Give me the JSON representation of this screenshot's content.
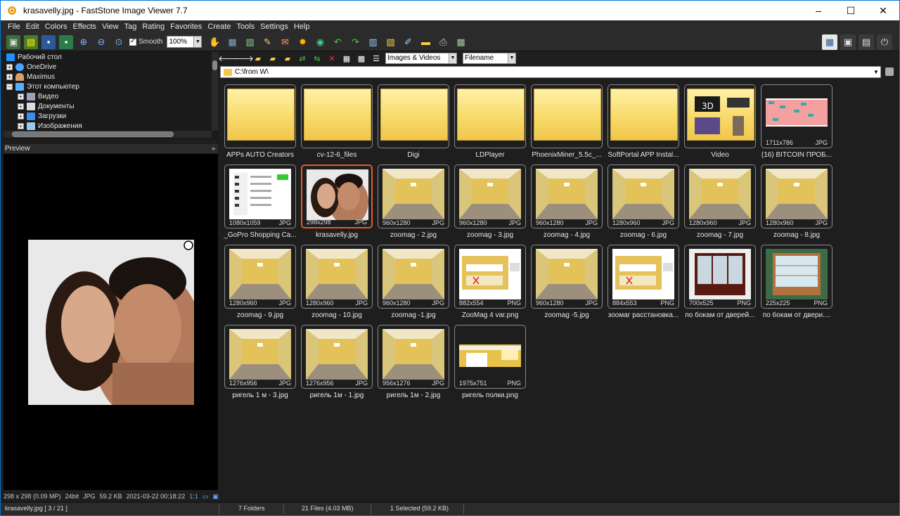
{
  "window": {
    "title": "krasavelly.jpg  -  FastStone Image Viewer 7.7",
    "controls": [
      "–",
      "☐",
      "✕"
    ]
  },
  "menu": [
    "File",
    "Edit",
    "Colors",
    "Effects",
    "View",
    "Tag",
    "Rating",
    "Favorites",
    "Create",
    "Tools",
    "Settings",
    "Help"
  ],
  "toolbar": {
    "smooth_label": "Smooth",
    "zoom_value": "100%"
  },
  "tree": {
    "items": [
      {
        "label": "Рабочий стол",
        "icon": "desktop-icon",
        "color": "#1e90ff"
      },
      {
        "label": "OneDrive",
        "icon": "cloud-icon",
        "color": "#4aa3ff"
      },
      {
        "label": "Maximus",
        "icon": "user-icon",
        "color": "#d9a066"
      },
      {
        "label": "Этот компьютер",
        "icon": "computer-icon",
        "color": "#5ab0ff"
      },
      {
        "label": "Видео",
        "icon": "video-folder-icon",
        "color": "#9aa4b5"
      },
      {
        "label": "Документы",
        "icon": "documents-icon",
        "color": "#dcdcdc"
      },
      {
        "label": "Загрузки",
        "icon": "downloads-icon",
        "color": "#3a8ee6"
      },
      {
        "label": "Изображения",
        "icon": "pictures-icon",
        "color": "#9ec7e8"
      }
    ]
  },
  "preview": {
    "header": "Preview",
    "info": [
      "298 x 298 (0.09 MP)",
      "24bit",
      "JPG",
      "59.2 KB",
      "2021-03-22 00:18:22",
      "1:1"
    ]
  },
  "navbar": {
    "filter_value": "Images & Videos",
    "sort_value": "Filename"
  },
  "path": "C:\\from W\\",
  "thumbnails": [
    {
      "caption": "APPs AUTO Creators",
      "type": "folder"
    },
    {
      "caption": "cv-12-6_files",
      "type": "folder"
    },
    {
      "caption": "Digi",
      "type": "folder"
    },
    {
      "caption": "LDPlayer",
      "type": "folder"
    },
    {
      "caption": "PhoenixMiner_5.5c_...",
      "type": "folder"
    },
    {
      "caption": "SoftPortal APP Instal...",
      "type": "folder"
    },
    {
      "caption": "Video",
      "type": "folder-video"
    },
    {
      "caption": "(16) BITCOIN ПРОБ...",
      "type": "sheet",
      "dims": "1711x786",
      "ext": "JPG"
    },
    {
      "caption": "_GoPro Shopping Ca...",
      "type": "web",
      "dims": "1080x1059",
      "ext": "JPG"
    },
    {
      "caption": "krasavelly.jpg",
      "type": "photo",
      "dims": "298x298",
      "ext": "JPG",
      "selected": true
    },
    {
      "caption": "zoomag - 2.jpg",
      "type": "room",
      "dims": "960x1280",
      "ext": "JPG"
    },
    {
      "caption": "zoomag - 3.jpg",
      "type": "room",
      "dims": "960x1280",
      "ext": "JPG"
    },
    {
      "caption": "zoomag - 4.jpg",
      "type": "room",
      "dims": "960x1280",
      "ext": "JPG"
    },
    {
      "caption": "zoomag - 6.jpg",
      "type": "room",
      "dims": "1280x960",
      "ext": "JPG"
    },
    {
      "caption": "zoomag - 7.jpg",
      "type": "room",
      "dims": "1280x960",
      "ext": "JPG"
    },
    {
      "caption": "zoomag - 8.jpg",
      "type": "room",
      "dims": "1280x960",
      "ext": "JPG"
    },
    {
      "caption": "zoomag - 9.jpg",
      "type": "room",
      "dims": "1280x960",
      "ext": "JPG"
    },
    {
      "caption": "zoomag - 10.jpg",
      "type": "room",
      "dims": "1280x960",
      "ext": "JPG"
    },
    {
      "caption": "zoomag -1.jpg",
      "type": "room",
      "dims": "960x1280",
      "ext": "JPG"
    },
    {
      "caption": "ZooMag 4 var.png",
      "type": "plan",
      "dims": "882x554",
      "ext": "PNG"
    },
    {
      "caption": "zoomag -5.jpg",
      "type": "room",
      "dims": "960x1280",
      "ext": "JPG"
    },
    {
      "caption": "зоомаг расстановка...",
      "type": "plan",
      "dims": "884x553",
      "ext": "PNG"
    },
    {
      "caption": "по бокам от дверей...",
      "type": "cabinet",
      "dims": "700x525",
      "ext": "PNG"
    },
    {
      "caption": "по бокам от двери....",
      "type": "cabinet2",
      "dims": "225x225",
      "ext": "PNG"
    },
    {
      "caption": "ригель 1 м - 3.jpg",
      "type": "room",
      "dims": "1276x956",
      "ext": "JPG"
    },
    {
      "caption": "ригель 1м - 1.jpg",
      "type": "room",
      "dims": "1276x956",
      "ext": "JPG"
    },
    {
      "caption": "ригель 1м - 2.jpg",
      "type": "room",
      "dims": "956x1276",
      "ext": "JPG"
    },
    {
      "caption": "ригель полки.png",
      "type": "shelf",
      "dims": "1975x751",
      "ext": "PNG"
    }
  ],
  "status": {
    "file": "krasavelly.jpg [ 3 / 21 ]",
    "folders": "7 Folders",
    "files": "21 Files (4.03 MB)",
    "selected": "1 Selected (59.2 KB)"
  },
  "colors": {
    "accent": "#0078d7",
    "selection": "#e35a2e",
    "folder": "#f7d866"
  }
}
